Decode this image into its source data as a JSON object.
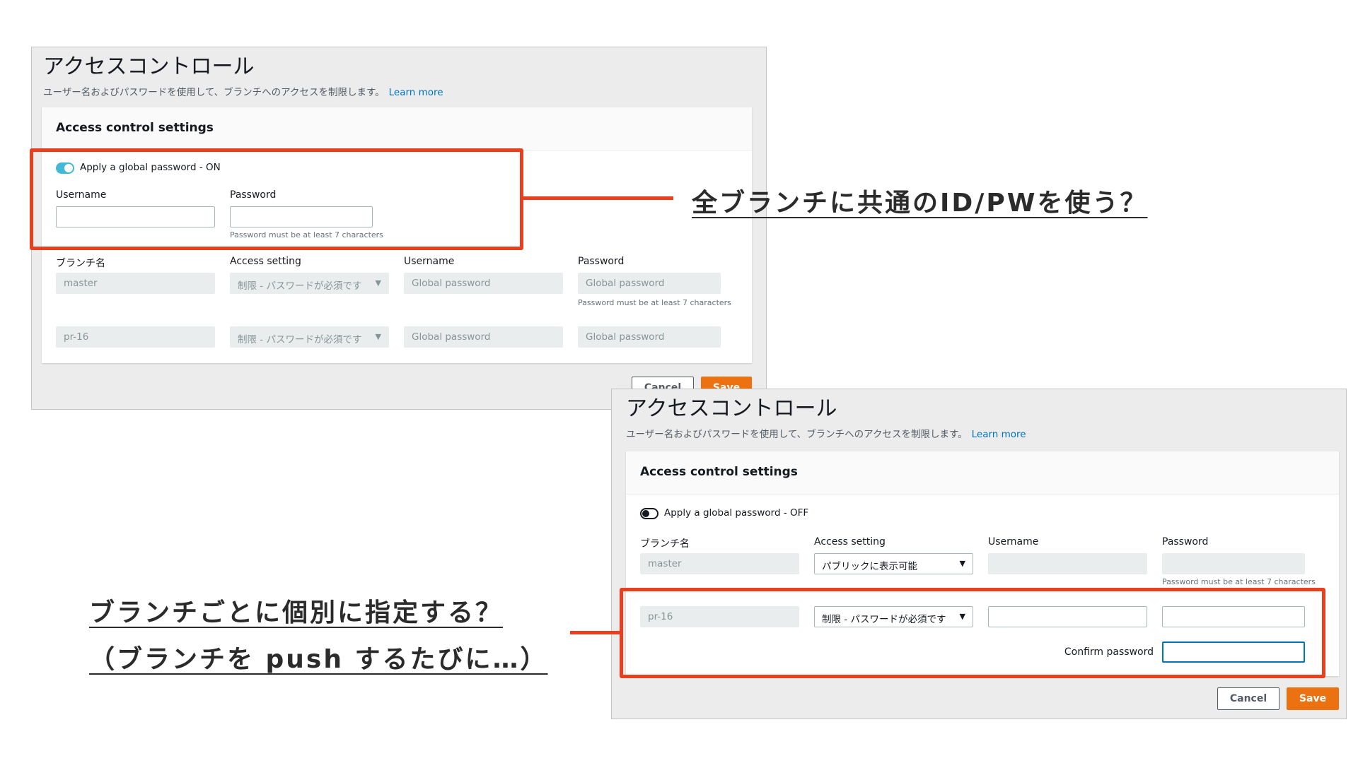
{
  "panel_on": {
    "title": "アクセスコントロール",
    "description": "ユーザー名およびパスワードを使用して、ブランチへのアクセスを制限します。",
    "learn_more": "Learn more",
    "card_title": "Access control settings",
    "toggle_label": "Apply a global password - ON",
    "username_label": "Username",
    "password_label": "Password",
    "password_hint": "Password must be at least 7 characters",
    "columns": [
      "ブランチ名",
      "Access setting",
      "Username",
      "Password"
    ],
    "rows": [
      {
        "branch": "master",
        "access": "制限 - パスワードが必須です",
        "username": "Global password",
        "password": "Global password",
        "hint": "Password must be at least 7 characters"
      },
      {
        "branch": "pr-16",
        "access": "制限 - パスワードが必須です",
        "username": "Global password",
        "password": "Global password"
      }
    ],
    "cancel": "Cancel",
    "save": "Save"
  },
  "panel_off": {
    "title": "アクセスコントロール",
    "description": "ユーザー名およびパスワードを使用して、ブランチへのアクセスを制限します。",
    "learn_more": "Learn more",
    "card_title": "Access control settings",
    "toggle_label": "Apply a global password - OFF",
    "columns": [
      "ブランチ名",
      "Access setting",
      "Username",
      "Password"
    ],
    "rows": [
      {
        "branch": "master",
        "access": "パブリックに表示可能",
        "hint": "Password must be at least 7 characters"
      },
      {
        "branch": "pr-16",
        "access": "制限 - パスワードが必須です"
      }
    ],
    "confirm_label": "Confirm password",
    "cancel": "Cancel",
    "save": "Save"
  },
  "callouts": {
    "global": "全ブランチに共通のID/PWを使う？",
    "per_branch_line1": "ブランチごとに個別に指定する？",
    "per_branch_line2": "（ブランチを push するたびに…）"
  },
  "colors": {
    "annotation": "#e8401f",
    "link": "#0073bb",
    "save": "#ec7211",
    "toggle_on": "#44b9d6"
  }
}
